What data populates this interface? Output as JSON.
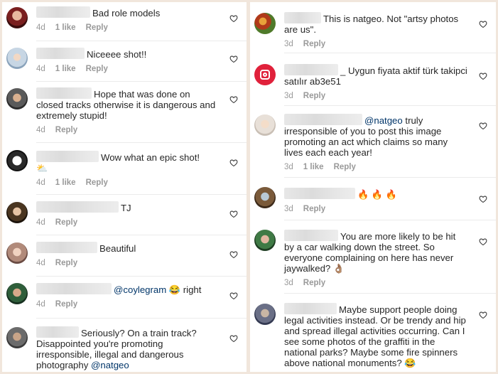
{
  "left_comments": [
    {
      "text": "Bad role models",
      "time": "4d",
      "likes": "1 like",
      "reply": "Reply"
    },
    {
      "text": "Niceeee shot!!",
      "time": "4d",
      "likes": "1 like",
      "reply": "Reply"
    },
    {
      "text": "Hope that was done on closed tracks otherwise it is dangerous and extremely stupid!",
      "time": "4d",
      "reply": "Reply"
    },
    {
      "text": "Wow what an epic shot!",
      "emoji": "⛅",
      "time": "4d",
      "likes": "1 like",
      "reply": "Reply"
    },
    {
      "text": "TJ",
      "time": "4d",
      "reply": "Reply"
    },
    {
      "text": "Beautiful",
      "time": "4d",
      "reply": "Reply"
    },
    {
      "mention": "@coylegram",
      "emoji": "😂",
      "after": "right",
      "time": "4d",
      "reply": "Reply"
    },
    {
      "text": "Seriously? On a train track? Disappointed you're promoting irresponsible, illegal and dangerous photography",
      "mention": "@natgeo"
    }
  ],
  "right_comments": [
    {
      "text": "This is natgeo. Not \"artsy photos are us\".",
      "time": "3d",
      "reply": "Reply"
    },
    {
      "username_partial": "_",
      "text": "Uygun fiyata aktif türk takipci satılır  ab3e51",
      "time": "3d",
      "reply": "Reply"
    },
    {
      "mention": "@natgeo",
      "text": "truly irresponsible of you to post this image promoting an act which claims so many lives each each year!",
      "time": "3d",
      "likes": "1 like",
      "reply": "Reply"
    },
    {
      "emoji": "🔥 🔥 🔥",
      "time": "3d",
      "reply": "Reply"
    },
    {
      "text": "You are more likely to be hit by a car walking down the street. So everyone complaining on here has never jaywalked?",
      "emoji": "👌🏽",
      "time": "3d",
      "reply": "Reply"
    },
    {
      "text": "Maybe support people doing legal activities instead.  Or be trendy and hip and spread illegal activities occurring.  Can I see some photos of the graffiti in the national parks?  Maybe some fire spinners above national monuments?",
      "emoji": "😂"
    }
  ],
  "colors": {
    "text": "#262626",
    "meta": "#999999",
    "mention": "#003569",
    "background": "#f1e6dc"
  },
  "icons": {
    "like": "heart-outline-icon"
  }
}
